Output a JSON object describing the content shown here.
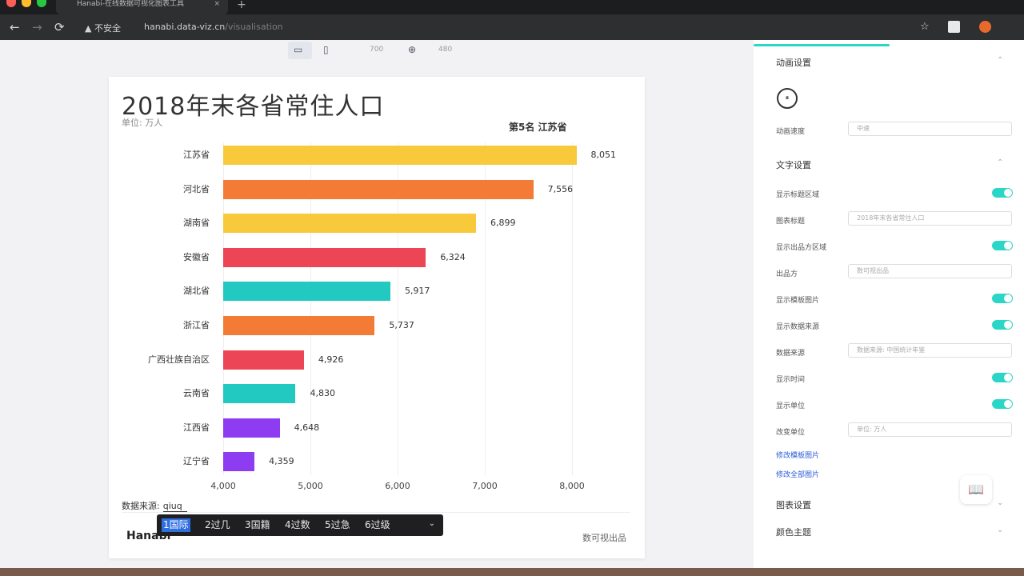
{
  "browser": {
    "tab_title": "Hanabi-在线数据可视化图表工具",
    "tab_close": "×",
    "new_tab": "+",
    "security": "不安全",
    "url_host": "hanabi.data-viz.cn",
    "url_path": "/visualisation",
    "back_icon": "←",
    "forward_icon": "→",
    "reload_icon": "⟳",
    "star_icon": "☆"
  },
  "device_bar": {
    "width_value": "700",
    "height_value": "480"
  },
  "chart_data": {
    "type": "bar",
    "orientation": "horizontal",
    "title": "2018年末各省常住人口",
    "subtitle": "单位: 万人",
    "rank_label": "第5名 江苏省",
    "categories": [
      "江苏省",
      "河北省",
      "湖南省",
      "安徽省",
      "湖北省",
      "浙江省",
      "广西壮族自治区",
      "云南省",
      "江西省",
      "辽宁省"
    ],
    "values": [
      8051,
      7556,
      6899,
      6324,
      5917,
      5737,
      4926,
      4830,
      4648,
      4359
    ],
    "value_labels": [
      "8,051",
      "7,556",
      "6,899",
      "6,324",
      "5,917",
      "5,737",
      "4,926",
      "4,830",
      "4,648",
      "4,359"
    ],
    "colors": [
      "#f8c93a",
      "#f47b35",
      "#f8c93a",
      "#ec4556",
      "#22c9c0",
      "#f47b35",
      "#ec4556",
      "#22c9c0",
      "#8d3cf1",
      "#8d3cf1"
    ],
    "xlim": [
      4000,
      8000
    ],
    "x_ticks": [
      "4,000",
      "5,000",
      "6,000",
      "7,000",
      "8,000"
    ],
    "grid": true
  },
  "footer": {
    "source_label": "数据来源:",
    "source_value": "qiuq",
    "logo_text": "Hanabi",
    "watermark": "数可视出品"
  },
  "ime": {
    "candidates": [
      "1国际",
      "2过几",
      "3国籍",
      "4过数",
      "5过急",
      "6过级"
    ],
    "expand_icon": "⌄"
  },
  "panel": {
    "animation_section": "动画设置",
    "play_icon": "⏸",
    "speed_label": "动画速度",
    "speed_value": "中速",
    "text_section": "文字设置",
    "rows": [
      {
        "label": "显示标题区域",
        "type": "toggle"
      },
      {
        "label": "图表标题",
        "type": "field",
        "value": "2018年末各省常住人口"
      },
      {
        "label": "显示出品方区域",
        "type": "toggle"
      },
      {
        "label": "出品方",
        "type": "field",
        "value": "数可视出品"
      },
      {
        "label": "显示模板图片",
        "type": "toggle"
      },
      {
        "label": "显示数据来源",
        "type": "toggle"
      },
      {
        "label": "数据来源",
        "type": "field",
        "value": "数据来源: 中国统计年鉴"
      },
      {
        "label": "显示时间",
        "type": "toggle"
      },
      {
        "label": "显示单位",
        "type": "toggle"
      },
      {
        "label": "改变单位",
        "type": "field",
        "value": "单位: 万人"
      }
    ],
    "link1": "修改模板图片",
    "link2": "修改全部图片",
    "chart_section": "图表设置",
    "color_section": "颜色主题",
    "chevron": "⌃",
    "chevron_down": "⌄",
    "help_icon": "📖"
  }
}
